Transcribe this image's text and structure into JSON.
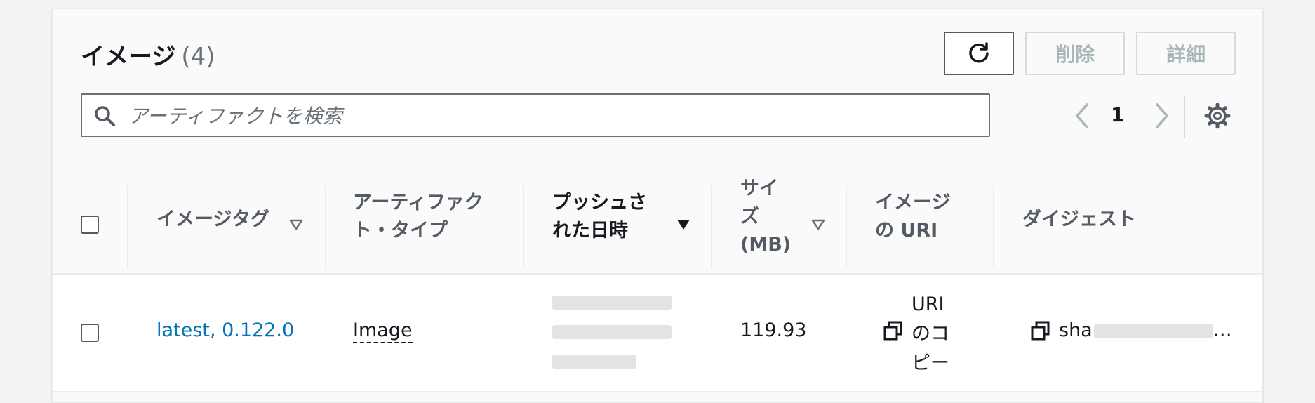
{
  "header": {
    "title": "イメージ",
    "count": "(4)",
    "delete_label": "削除",
    "details_label": "詳細"
  },
  "search": {
    "placeholder": "アーティファクトを検索"
  },
  "pagination": {
    "current_page": "1"
  },
  "columns": {
    "image_tag": "イメージタグ",
    "artifact_type_1": "アーティファク",
    "artifact_type_2": "ト・タイプ",
    "pushed_at_1": "プッシュさ",
    "pushed_at_2": "れた日時",
    "size_1": "サイ",
    "size_2": "ズ",
    "size_3": "(MB)",
    "uri_1": "イメージ",
    "uri_2": "の URI",
    "digest": "ダイジェスト"
  },
  "rows": [
    {
      "image_tag": "latest, 0.122.0",
      "artifact_type": "Image",
      "size": "119.93",
      "uri_copy_1": "URI",
      "uri_copy_2": "のコ",
      "uri_copy_3": "ピー",
      "digest_prefix": "sha",
      "digest_ellipsis": "…"
    }
  ],
  "colors": {
    "link": "#0073bb",
    "text": "#16191f",
    "muted": "#687078",
    "disabled": "#aab7b8"
  },
  "icons": [
    "refresh-icon",
    "search-icon",
    "chevron-left-icon",
    "chevron-right-icon",
    "gear-icon",
    "sort-icon",
    "copy-icon"
  ]
}
